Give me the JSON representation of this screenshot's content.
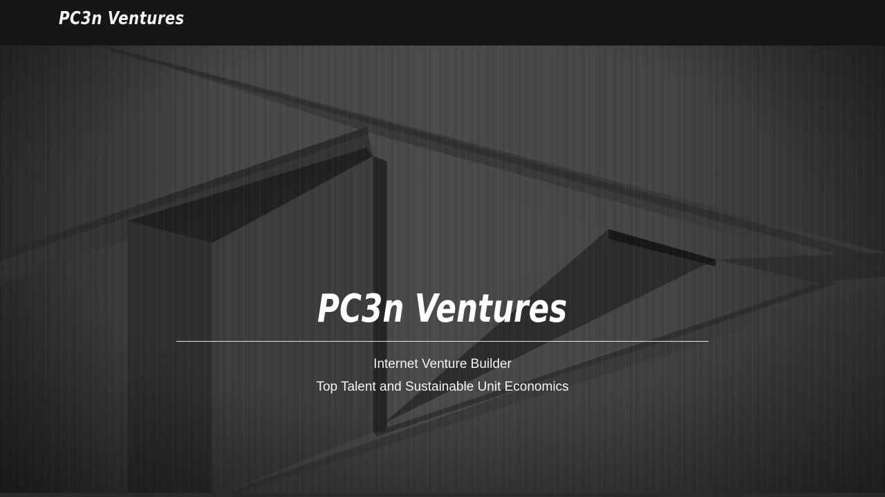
{
  "header": {
    "logo_text": "PC3n Ventures"
  },
  "hero": {
    "title": "PC3n Ventures",
    "tagline": "Internet Venture Builder",
    "subtagline": "Top Talent and Sustainable Unit Economics"
  },
  "colors": {
    "header_background": "#161616",
    "hero_background": "#3c3c3c",
    "text": "#ffffff"
  }
}
